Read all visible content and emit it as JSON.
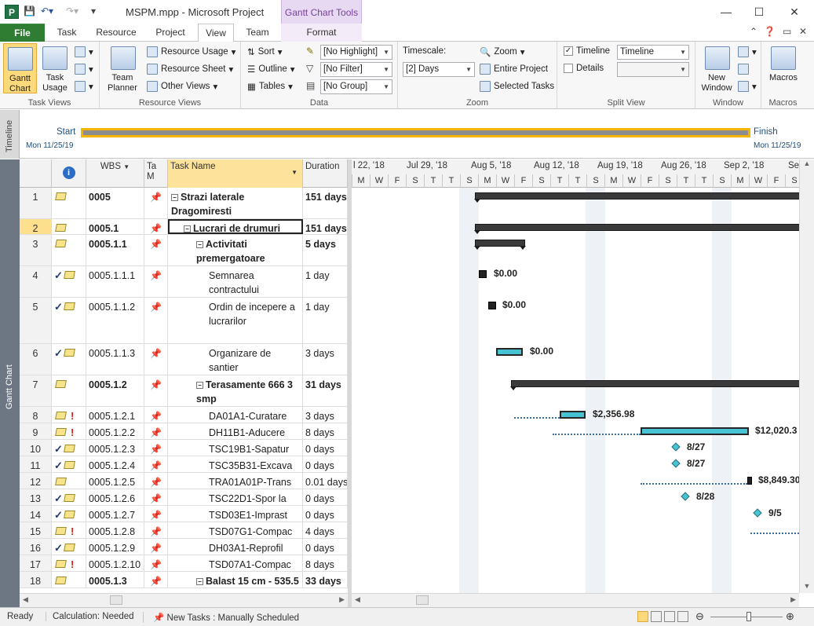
{
  "window": {
    "title": "MSPM.mpp  -  Microsoft Project",
    "contextual_tab_group": "Gantt Chart Tools",
    "app_letter": "P"
  },
  "tabs": [
    {
      "label": "File"
    },
    {
      "label": "Task"
    },
    {
      "label": "Resource"
    },
    {
      "label": "Project"
    },
    {
      "label": "View"
    },
    {
      "label": "Team"
    },
    {
      "label": "Format"
    }
  ],
  "ribbon": {
    "task_views": {
      "gantt": "Gantt Chart",
      "gantt_dd": "Chart",
      "task_usage": "Task Usage",
      "label": "Task Views"
    },
    "resource_views": {
      "team_planner": "Team Planner",
      "resource_usage": "Resource Usage",
      "resource_sheet": "Resource Sheet",
      "other_views": "Other Views",
      "label": "Resource Views"
    },
    "data": {
      "sort": "Sort",
      "outline": "Outline",
      "tables": "Tables",
      "highlight": "[No Highlight]",
      "filter": "[No Filter]",
      "group": "[No Group]",
      "label": "Data"
    },
    "zoom": {
      "timescale_label": "Timescale:",
      "timescale_value": "[2] Days",
      "zoom": "Zoom",
      "entire_project": "Entire Project",
      "selected_tasks": "Selected Tasks",
      "label": "Zoom"
    },
    "split_view": {
      "timeline": "Timeline",
      "timeline_value": "Timeline",
      "details": "Details",
      "label": "Split View"
    },
    "window": {
      "new_window": "New Window",
      "label": "Window"
    },
    "macros": {
      "macros": "Macros",
      "label": "Macros"
    }
  },
  "timeline": {
    "side_label": "Timeline",
    "start_label": "Start",
    "finish_label": "Finish",
    "start_date": "Mon 11/25/19",
    "finish_date": "Mon 11/25/19"
  },
  "gantt_side_label": "Gantt Chart",
  "columns": {
    "wbs": "WBS",
    "mode": "Ta M",
    "name": "Task Name",
    "duration": "Duration"
  },
  "rows": [
    {
      "id": "1",
      "wbs": "0005",
      "name": "Strazi laterale Dragomiresti",
      "dur": "151 days",
      "bold": true,
      "indent": 0,
      "check": false,
      "person": false
    },
    {
      "id": "2",
      "wbs": "0005.1",
      "name": "Lucrari de drumuri",
      "dur": "151 days",
      "bold": true,
      "indent": 1,
      "check": false,
      "person": false
    },
    {
      "id": "3",
      "wbs": "0005.1.1",
      "name": "Activitati premergatoare",
      "dur": "5 days",
      "bold": true,
      "indent": 2,
      "check": false,
      "person": false
    },
    {
      "id": "4",
      "wbs": "0005.1.1.1",
      "name": "Semnarea contractului",
      "dur": "1 day",
      "bold": false,
      "indent": 3,
      "check": true,
      "person": false
    },
    {
      "id": "5",
      "wbs": "0005.1.1.2",
      "name": "Ordin de incepere a lucrarilor",
      "dur": "1 day",
      "bold": false,
      "indent": 3,
      "check": true,
      "person": false
    },
    {
      "id": "6",
      "wbs": "0005.1.1.3",
      "name": "Organizare de santier",
      "dur": "3 days",
      "bold": false,
      "indent": 3,
      "check": true,
      "person": false
    },
    {
      "id": "7",
      "wbs": "0005.1.2",
      "name": "Terasamente 666 3 smp",
      "dur": "31 days",
      "bold": true,
      "indent": 2,
      "check": false,
      "person": false
    },
    {
      "id": "8",
      "wbs": "0005.1.2.1",
      "name": "DA01A1-Curatare",
      "dur": "3 days",
      "bold": false,
      "indent": 3,
      "check": false,
      "person": true
    },
    {
      "id": "9",
      "wbs": "0005.1.2.2",
      "name": "DH11B1-Aducere",
      "dur": "8 days",
      "bold": false,
      "indent": 3,
      "check": false,
      "person": true
    },
    {
      "id": "10",
      "wbs": "0005.1.2.3",
      "name": "TSC19B1-Sapatur",
      "dur": "0 days",
      "bold": false,
      "indent": 3,
      "check": true,
      "person": false
    },
    {
      "id": "11",
      "wbs": "0005.1.2.4",
      "name": "TSC35B31-Excava",
      "dur": "0 days",
      "bold": false,
      "indent": 3,
      "check": true,
      "person": false
    },
    {
      "id": "12",
      "wbs": "0005.1.2.5",
      "name": "TRA01A01P-Trans",
      "dur": "0.01 days",
      "bold": false,
      "indent": 3,
      "check": false,
      "person": false
    },
    {
      "id": "13",
      "wbs": "0005.1.2.6",
      "name": "TSC22D1-Spor la",
      "dur": "0 days",
      "bold": false,
      "indent": 3,
      "check": true,
      "person": false
    },
    {
      "id": "14",
      "wbs": "0005.1.2.7",
      "name": "TSD03E1-Imprast",
      "dur": "0 days",
      "bold": false,
      "indent": 3,
      "check": true,
      "person": false
    },
    {
      "id": "15",
      "wbs": "0005.1.2.8",
      "name": "TSD07G1-Compac",
      "dur": "4 days",
      "bold": false,
      "indent": 3,
      "check": false,
      "person": true
    },
    {
      "id": "16",
      "wbs": "0005.1.2.9",
      "name": "DH03A1-Reprofil",
      "dur": "0 days",
      "bold": false,
      "indent": 3,
      "check": true,
      "person": false
    },
    {
      "id": "17",
      "wbs": "0005.1.2.10",
      "name": "TSD07A1-Compac",
      "dur": "8 days",
      "bold": false,
      "indent": 3,
      "check": false,
      "person": true
    },
    {
      "id": "18",
      "wbs": "0005.1.3",
      "name": "Balast 15 cm - 535.5",
      "dur": "33 days",
      "bold": true,
      "indent": 2,
      "check": false,
      "person": false
    }
  ],
  "timescale": {
    "weeks": [
      "l 22, '18",
      "Jul 29, '18",
      "Aug 5, '18",
      "Aug 12, '18",
      "Aug 19, '18",
      "Aug 26, '18",
      "Sep 2, '18",
      "Sep"
    ],
    "days": [
      "M",
      "W",
      "F",
      "S",
      "T",
      "T",
      "S",
      "M",
      "W",
      "F",
      "S",
      "T",
      "T",
      "S",
      "M",
      "W",
      "F",
      "S",
      "T",
      "T",
      "S",
      "M",
      "W",
      "F",
      "S"
    ]
  },
  "gantt_labels": {
    "c4": "$0.00",
    "c5": "$0.00",
    "c6": "$0.00",
    "c8": "$2,356.98",
    "c9": "$12,020.3",
    "c10": "8/27",
    "c11": "8/27",
    "c12": "$8,849.30",
    "c13": "8/28",
    "c14": "9/5"
  },
  "status": {
    "ready": "Ready",
    "calculation": "Calculation: Needed",
    "new_tasks": "New Tasks : Manually Scheduled"
  }
}
